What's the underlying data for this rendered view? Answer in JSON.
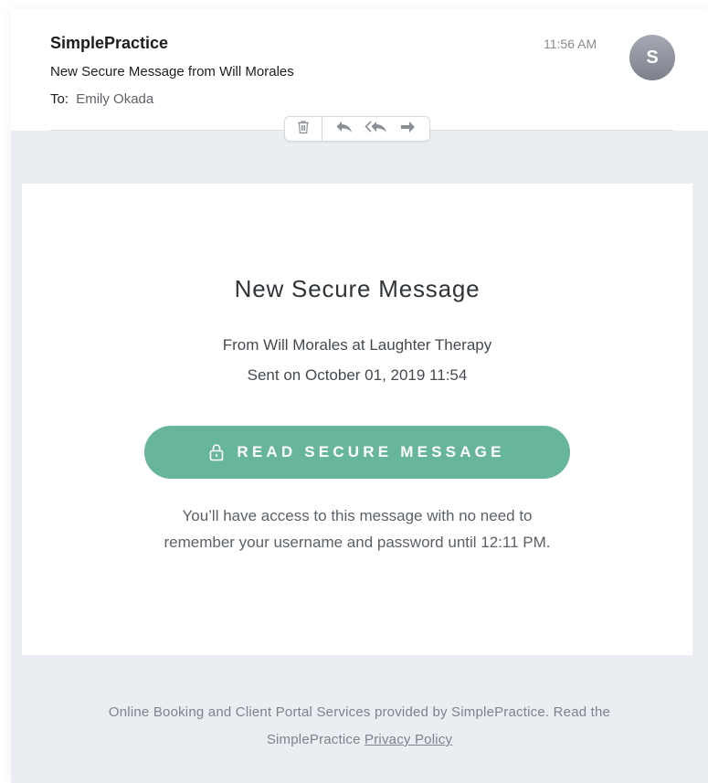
{
  "header": {
    "sender": "SimplePractice",
    "subject": "New Secure Message from Will Morales",
    "to_label": "To:",
    "to_name": "Emily Okada",
    "time": "11:56 AM",
    "avatar_initial": "S"
  },
  "toolbar": {
    "icons": [
      "trash-icon",
      "reply-icon",
      "reply-all-icon",
      "forward-icon"
    ]
  },
  "message": {
    "title": "New Secure Message",
    "from_line": "From Will Morales at Laughter Therapy",
    "sent_line": "Sent on October 01, 2019 11:54",
    "button_label": "READ SECURE MESSAGE",
    "access_line_1": "You’ll have access to this message with no need to",
    "access_line_2": "remember your username and password until 12:11 PM."
  },
  "footer": {
    "line_1": "Online Booking and Client Portal Services provided by SimplePractice. Read the",
    "line_2_prefix": "SimplePractice",
    "privacy_link": "Privacy Policy"
  },
  "colors": {
    "button": "#68b69a",
    "background": "#eaedf2",
    "card": "#ffffff",
    "avatar": "#8a8f98"
  }
}
